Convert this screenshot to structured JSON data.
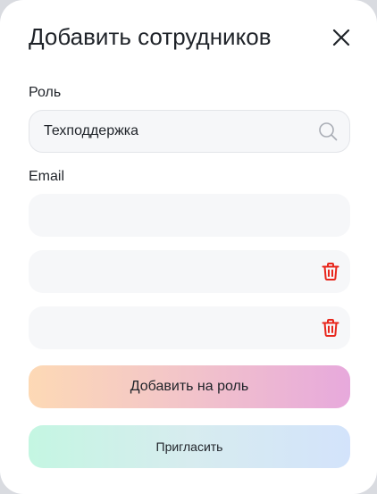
{
  "modal": {
    "title": "Добавить сотрудников"
  },
  "role": {
    "label": "Роль",
    "value": "Техподдержка"
  },
  "email": {
    "label": "Email",
    "fields": [
      {
        "value": ""
      },
      {
        "value": ""
      },
      {
        "value": ""
      }
    ]
  },
  "buttons": {
    "add_to_role": "Добавить на роль",
    "invite": "Пригласить"
  },
  "colors": {
    "delete_icon": "#e8261c",
    "field_bg": "#f6f7f9"
  },
  "icons": {
    "close": "close-icon",
    "search": "search-icon",
    "delete": "trash-icon"
  }
}
